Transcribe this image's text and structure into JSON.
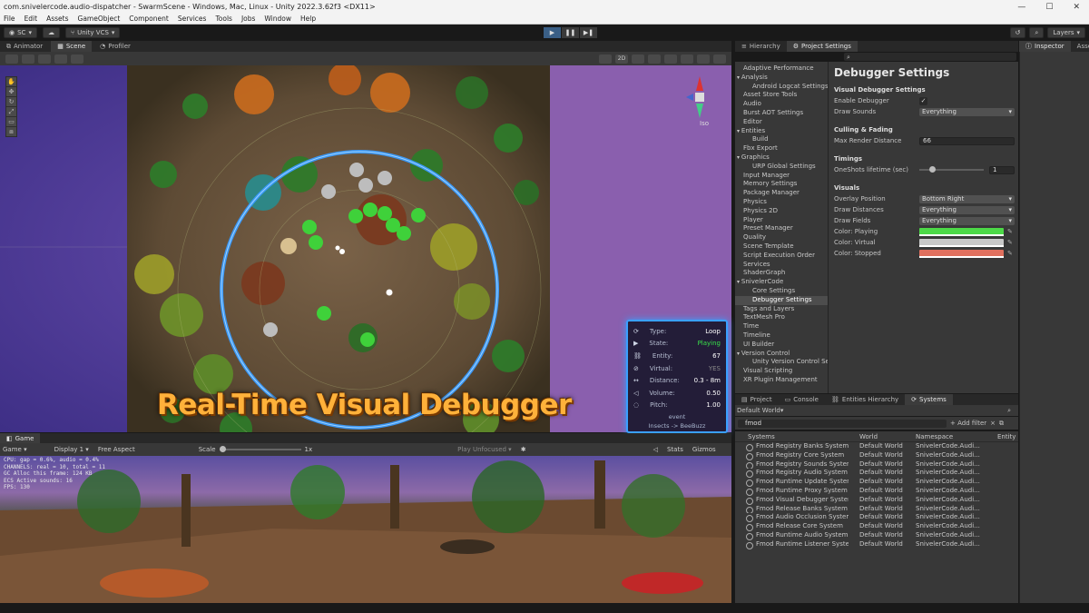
{
  "window": {
    "title": "com.snivelercode.audio-dispatcher - SwarmScene - Windows, Mac, Linux - Unity 2022.3.62f3 <DX11>"
  },
  "menu": [
    "File",
    "Edit",
    "Assets",
    "GameObject",
    "Component",
    "Services",
    "Tools",
    "Jobs",
    "Window",
    "Help"
  ],
  "toolbar": {
    "account": "SC",
    "vcs": "Unity VCS",
    "layers": "Layers"
  },
  "scene_tabs": [
    "Animator",
    "Scene",
    "Profiler"
  ],
  "scene_toolbar": {
    "mode_2d": "2D",
    "gizmo_iso": "Iso"
  },
  "overlay": {
    "rows": [
      {
        "key": "Type:",
        "value": "Loop"
      },
      {
        "key": "State:",
        "value": "Playing"
      },
      {
        "key": "Entity:",
        "value": "67"
      },
      {
        "key": "Virtual:",
        "value": "YES"
      },
      {
        "key": "Distance:",
        "value": "0.3 - 8m"
      },
      {
        "key": "Volume:",
        "value": "0.50"
      },
      {
        "key": "Pitch:",
        "value": "1.00"
      }
    ],
    "footer_line1": "event",
    "footer_line2": "Insects -> BeeBuzz"
  },
  "banner": "Real-Time Visual Debugger",
  "game": {
    "tab": "Game",
    "display_mode": "Game",
    "display": "Display 1",
    "aspect": "Free Aspect",
    "scale_label": "Scale",
    "scale_value": "1x",
    "play_focus": "Play Unfocused",
    "stats_btn": "Stats",
    "gizmos_btn": "Gizmos",
    "stats_lines": [
      "CPU: gap = 0.6%, audio = 0.4%",
      "CHANNELS: real = 10, total = 11",
      "GC Alloc this frame: 124 KB",
      "ECS Active sounds: 16",
      "FPS: 130"
    ]
  },
  "right_tabs": [
    "Hierarchy",
    "Project Settings"
  ],
  "settings_tree": [
    {
      "label": "Adaptive Performance",
      "level": 0
    },
    {
      "label": "Analysis",
      "level": 0,
      "expanded": true
    },
    {
      "label": "Android Logcat Settings",
      "level": 1
    },
    {
      "label": "Asset Store Tools",
      "level": 0
    },
    {
      "label": "Audio",
      "level": 0
    },
    {
      "label": "Burst AOT Settings",
      "level": 0
    },
    {
      "label": "Editor",
      "level": 0
    },
    {
      "label": "Entities",
      "level": 0,
      "expanded": true
    },
    {
      "label": "Build",
      "level": 1
    },
    {
      "label": "Fbx Export",
      "level": 0
    },
    {
      "label": "Graphics",
      "level": 0,
      "expanded": true
    },
    {
      "label": "URP Global Settings",
      "level": 1
    },
    {
      "label": "Input Manager",
      "level": 0
    },
    {
      "label": "Memory Settings",
      "level": 0
    },
    {
      "label": "Package Manager",
      "level": 0
    },
    {
      "label": "Physics",
      "level": 0
    },
    {
      "label": "Physics 2D",
      "level": 0
    },
    {
      "label": "Player",
      "level": 0
    },
    {
      "label": "Preset Manager",
      "level": 0
    },
    {
      "label": "Quality",
      "level": 0
    },
    {
      "label": "Scene Template",
      "level": 0
    },
    {
      "label": "Script Execution Order",
      "level": 0
    },
    {
      "label": "Services",
      "level": 0
    },
    {
      "label": "ShaderGraph",
      "level": 0
    },
    {
      "label": "SnivelerCode",
      "level": 0,
      "expanded": true
    },
    {
      "label": "Core Settings",
      "level": 1
    },
    {
      "label": "Debugger Settings",
      "level": 1,
      "selected": true
    },
    {
      "label": "Tags and Layers",
      "level": 0
    },
    {
      "label": "TextMesh Pro",
      "level": 0
    },
    {
      "label": "Time",
      "level": 0
    },
    {
      "label": "Timeline",
      "level": 0
    },
    {
      "label": "UI Builder",
      "level": 0
    },
    {
      "label": "Version Control",
      "level": 0,
      "expanded": true
    },
    {
      "label": "Unity Version Control Se",
      "level": 1
    },
    {
      "label": "Visual Scripting",
      "level": 0
    },
    {
      "label": "XR Plugin Management",
      "level": 0
    }
  ],
  "settings": {
    "title": "Debugger Settings",
    "sections": {
      "visual_debugger": "Visual Debugger Settings",
      "culling": "Culling & Fading",
      "timings": "Timings",
      "visuals": "Visuals"
    },
    "enable_debugger": "Enable Debugger",
    "enable_check": "✓",
    "draw_sounds": {
      "label": "Draw Sounds",
      "value": "Everything"
    },
    "max_render_distance": {
      "label": "Max Render Distance",
      "value": "66"
    },
    "oneshots_lifetime": {
      "label": "OneShots lifetime (sec)",
      "value": "1",
      "level": 0.15
    },
    "overlay_position": {
      "label": "Overlay Position",
      "value": "Bottom Right"
    },
    "draw_distances": {
      "label": "Draw Distances",
      "value": "Everything"
    },
    "draw_fields": {
      "label": "Draw Fields",
      "value": "Everything"
    },
    "color_playing": {
      "label": "Color: Playing",
      "color": "#4cd947"
    },
    "color_virtual": {
      "label": "Color: Virtual",
      "color": "#c8c8c8"
    },
    "color_stopped": {
      "label": "Color: Stopped",
      "color": "#e0705e"
    }
  },
  "inspector_tabs": [
    "Inspector",
    "Asse"
  ],
  "systems_tabs": [
    "Project",
    "Console",
    "Entities Hierarchy",
    "Systems"
  ],
  "systems": {
    "world": "Default World",
    "filter_text": "fmod",
    "add_filter": "+ Add filter",
    "clear": "×",
    "headers": [
      "Systems",
      "World",
      "Namespace",
      "Entity"
    ],
    "rows": [
      {
        "name": "Fmod Registry Banks System",
        "world": "Default World",
        "ns": "SnivelerCode.Audi..."
      },
      {
        "name": "Fmod Registry Core System",
        "world": "Default World",
        "ns": "SnivelerCode.Audi..."
      },
      {
        "name": "Fmod Registry Sounds System",
        "world": "Default World",
        "ns": "SnivelerCode.Audi..."
      },
      {
        "name": "Fmod Registry Audio System",
        "world": "Default World",
        "ns": "SnivelerCode.Audi..."
      },
      {
        "name": "Fmod Runtime Update System",
        "world": "Default World",
        "ns": "SnivelerCode.Audi..."
      },
      {
        "name": "Fmod Runtime Proxy System",
        "world": "Default World",
        "ns": "SnivelerCode.Audi..."
      },
      {
        "name": "Fmod Visual Debugger System",
        "world": "Default World",
        "ns": "SnivelerCode.Audi..."
      },
      {
        "name": "Fmod Release Banks System",
        "world": "Default World",
        "ns": "SnivelerCode.Audi..."
      },
      {
        "name": "Fmod Audio Occlusion System",
        "world": "Default World",
        "ns": "SnivelerCode.Audi..."
      },
      {
        "name": "Fmod Release Core System",
        "world": "Default World",
        "ns": "SnivelerCode.Audi..."
      },
      {
        "name": "Fmod Runtime Audio System",
        "world": "Default World",
        "ns": "SnivelerCode.Audi..."
      },
      {
        "name": "Fmod Runtime Listener System",
        "world": "Default World",
        "ns": "SnivelerCode.Audi..."
      }
    ]
  }
}
